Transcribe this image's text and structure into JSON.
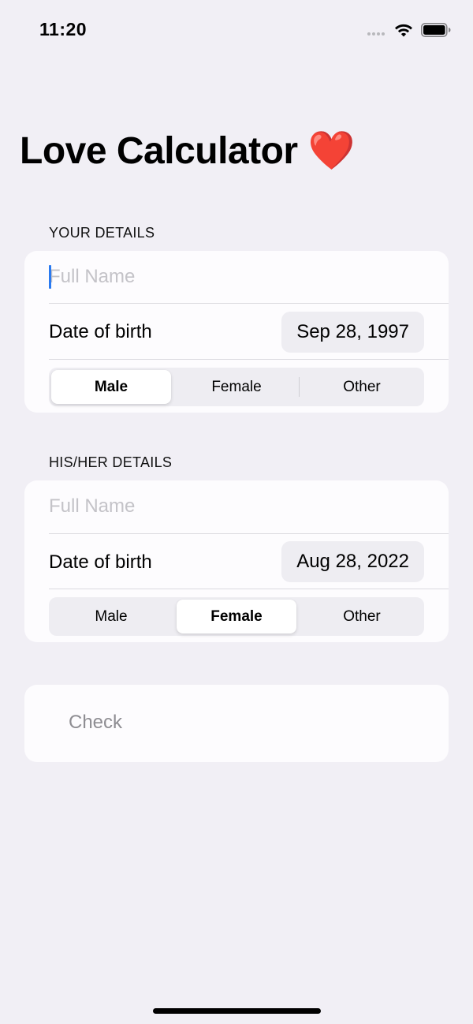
{
  "status_bar": {
    "time": "11:20"
  },
  "title": {
    "text": "Love Calculator",
    "emoji": "❤️"
  },
  "your_details": {
    "header": "YOUR DETAILS",
    "name_placeholder": "Full Name",
    "name_value": "",
    "dob_label": "Date of birth",
    "dob_value": "Sep 28, 1997",
    "gender_options": [
      "Male",
      "Female",
      "Other"
    ],
    "gender_selected": "Male"
  },
  "partner_details": {
    "header": "HIS/HER DETAILS",
    "name_placeholder": "Full Name",
    "name_value": "",
    "dob_label": "Date of birth",
    "dob_value": "Aug 28, 2022",
    "gender_options": [
      "Male",
      "Female",
      "Other"
    ],
    "gender_selected": "Female"
  },
  "check_button": {
    "label": "Check"
  },
  "colors": {
    "background": "#f1eff5",
    "card": "#fdfcfe",
    "accent_caret": "#2a7af0",
    "heart": "#e32128",
    "placeholder": "#c4c3c8"
  }
}
